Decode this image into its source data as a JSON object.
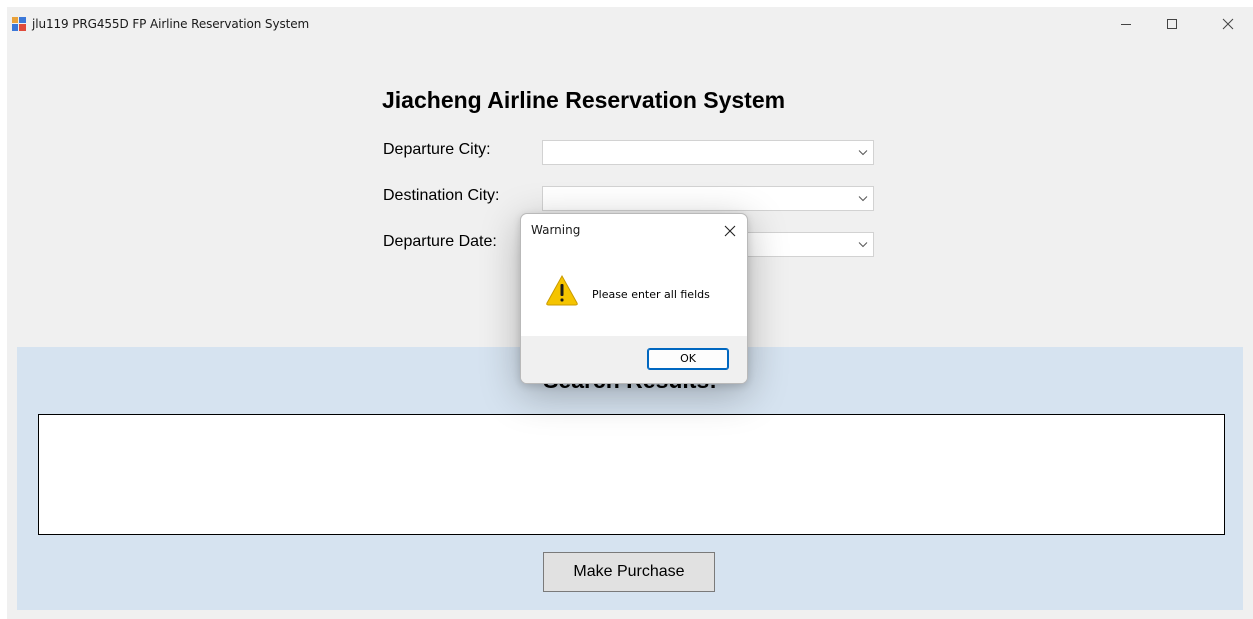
{
  "window": {
    "title": "jlu119 PRG455D FP Airline Reservation System",
    "icon": "app-icon"
  },
  "form": {
    "title": "Jiacheng Airline Reservation System",
    "fields": [
      {
        "label": "Departure City:",
        "value": ""
      },
      {
        "label": "Destination City:",
        "value": ""
      },
      {
        "label": "Departure Date:",
        "value": ""
      }
    ]
  },
  "results": {
    "heading": "Search Results:",
    "items": [],
    "purchase_label": "Make Purchase"
  },
  "dialog": {
    "title": "Warning",
    "icon": "warning-icon",
    "message": "Please enter all fields",
    "ok_label": "OK"
  },
  "colors": {
    "window_bg": "#f0f0f0",
    "results_panel": "#d6e3f0",
    "accent": "#0067c0",
    "warning": "#f5c400"
  }
}
